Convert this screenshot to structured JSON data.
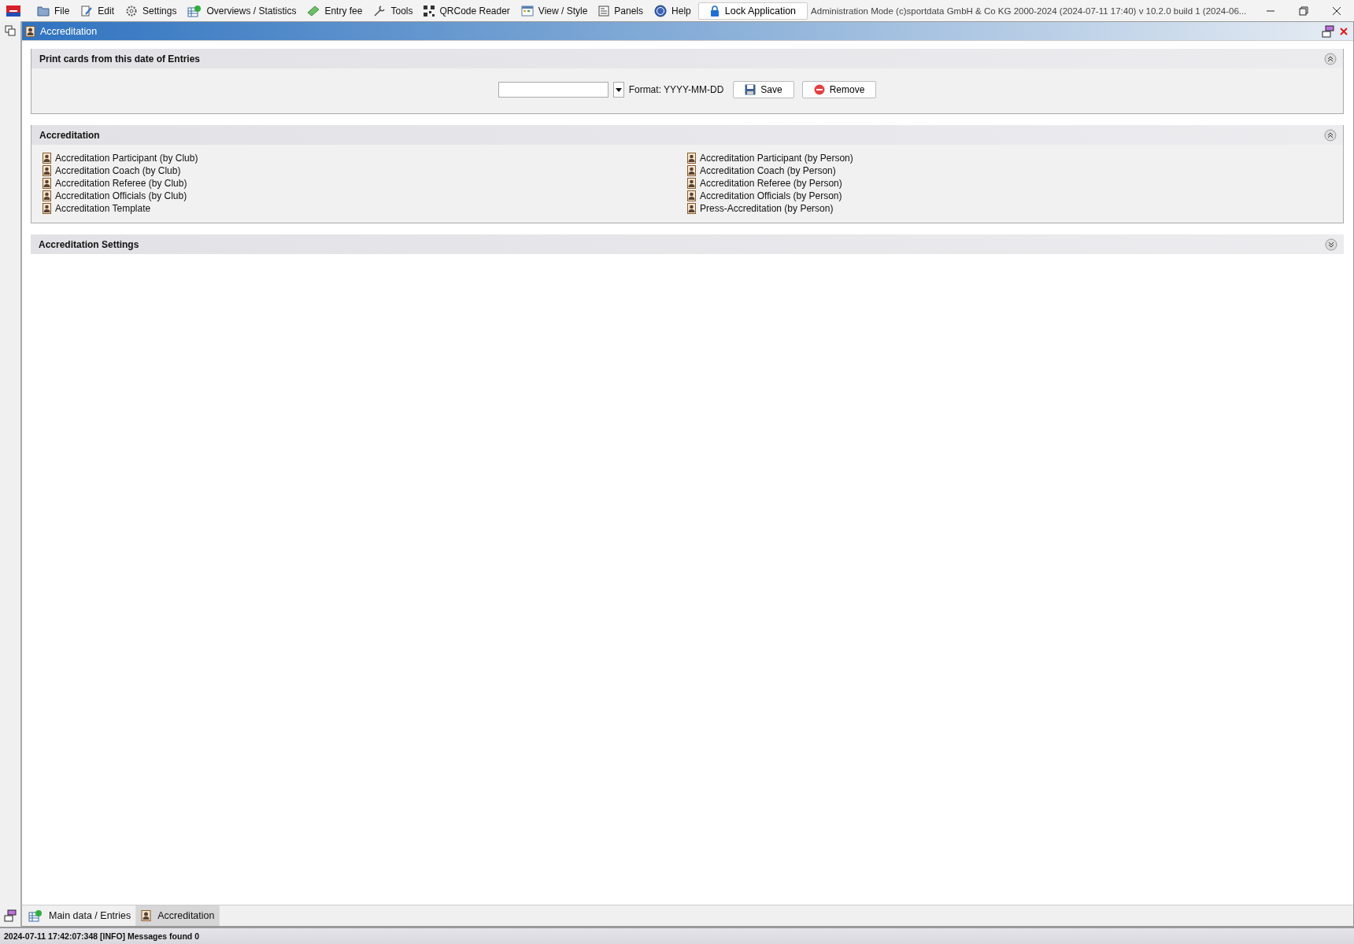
{
  "menu": [
    {
      "label": "File"
    },
    {
      "label": "Edit"
    },
    {
      "label": "Settings"
    },
    {
      "label": "Overviews / Statistics"
    },
    {
      "label": "Entry fee"
    },
    {
      "label": "Tools"
    },
    {
      "label": "QRCode Reader"
    },
    {
      "label": "View / Style"
    },
    {
      "label": "Panels"
    },
    {
      "label": "Help"
    }
  ],
  "lock_button": "Lock Application",
  "app_info": "Administration Mode (c)sportdata GmbH & Co KG 2000-2024 (2024-07-11 17:40)  v 10.2.0 build 1 (2024-06...",
  "frame": {
    "title": "Accreditation"
  },
  "sections": [
    {
      "kind": "date",
      "title": "Print cards from this date of Entries",
      "expanded": true,
      "format_label": "Format: YYYY-MM-DD",
      "buttons": [
        "Save",
        "Remove"
      ]
    },
    {
      "kind": "links",
      "title": "Accreditation",
      "expanded": true,
      "columns": [
        [
          "Accreditation Participant (by Club)",
          "Accreditation Coach (by Club)",
          "Accreditation Referee (by Club)",
          "Accreditation Officials (by Club)",
          "Accreditation Template"
        ],
        [
          "Accreditation Participant (by Person)",
          "Accreditation Coach (by Person)",
          "Accreditation Referee (by Person)",
          "Accreditation Officials (by Person)",
          "Press-Accreditation (by Person)"
        ]
      ]
    },
    {
      "title": "Accreditation Settings",
      "expanded": false
    }
  ],
  "tabs": [
    {
      "label": "Main data / Entries",
      "selected": false
    },
    {
      "label": "Accreditation",
      "selected": true
    }
  ],
  "status_bar": "2024-07-11 17:42:07:348 [INFO] Messages found 0"
}
